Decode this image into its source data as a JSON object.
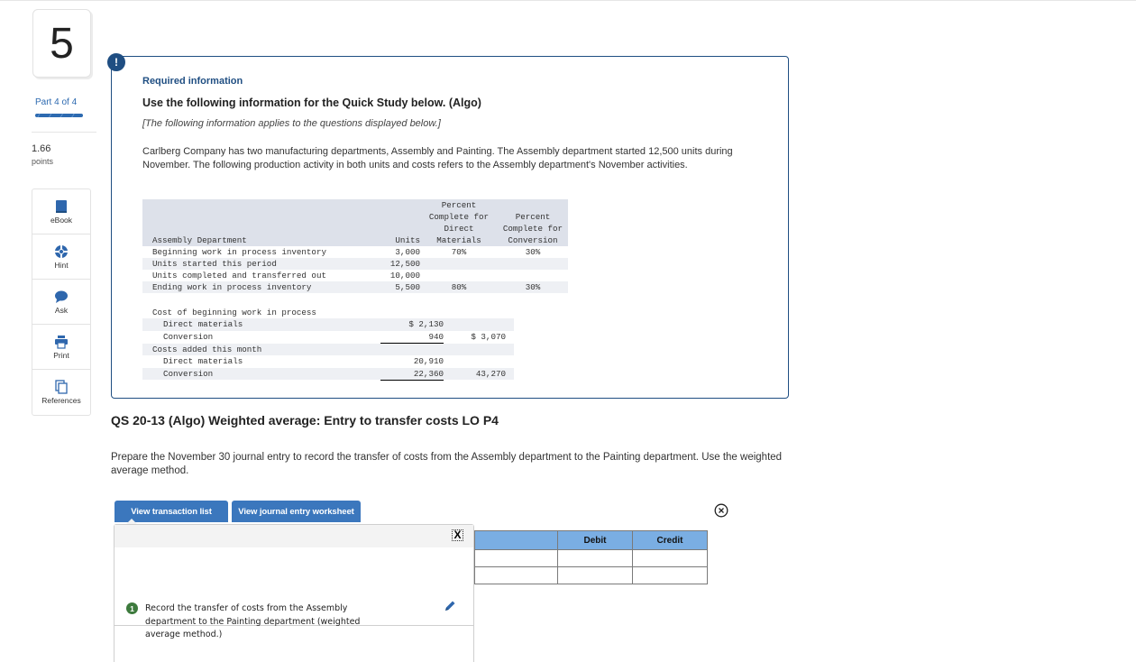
{
  "question": {
    "number": "5",
    "part_label": "Part",
    "part_current": "4",
    "part_of": "of 4",
    "part_progress": 1.0,
    "points_value": "1.66",
    "points_label": "points"
  },
  "tools": [
    {
      "label": "eBook",
      "icon": "book-icon"
    },
    {
      "label": "Hint",
      "icon": "lifebuoy-icon"
    },
    {
      "label": "Ask",
      "icon": "speech-bubble-icon"
    },
    {
      "label": "Print",
      "icon": "printer-icon"
    },
    {
      "label": "References",
      "icon": "copies-icon"
    }
  ],
  "info": {
    "badge": "!",
    "required": "Required information",
    "heading": "Use the following information for the Quick Study below. (Algo)",
    "applies": "[The following information applies to the questions displayed below.]",
    "paragraph": "Carlberg Company has two manufacturing departments, Assembly and Painting. The Assembly department started 12,500 units during November. The following production activity in both units and costs refers to the Assembly department's November activities."
  },
  "units_table": {
    "headers": {
      "dept": "Assembly Department",
      "units": "Units",
      "dm_lines": [
        "Percent",
        "Complete for",
        "Direct",
        "Materials"
      ],
      "conv_lines": [
        "Percent",
        "Complete for",
        "Conversion"
      ]
    },
    "rows": [
      {
        "label": "Beginning work in process inventory",
        "units": "3,000",
        "dm": "70%",
        "conv": "30%"
      },
      {
        "label": "Units started this period",
        "units": "12,500",
        "dm": "",
        "conv": ""
      },
      {
        "label": "Units completed and transferred out",
        "units": "10,000",
        "dm": "",
        "conv": ""
      },
      {
        "label": "Ending work in process inventory",
        "units": "5,500",
        "dm": "80%",
        "conv": "30%"
      }
    ]
  },
  "cost_table": {
    "rows": [
      {
        "label": "Cost of beginning work in process",
        "amount": "",
        "total": "",
        "indent": false
      },
      {
        "label": "Direct materials",
        "amount": "$ 2,130",
        "total": "",
        "indent": true
      },
      {
        "label": "Conversion",
        "amount": "940",
        "total": "$ 3,070",
        "indent": true
      },
      {
        "label": "Costs added this month",
        "amount": "",
        "total": "",
        "indent": false
      },
      {
        "label": "Direct materials",
        "amount": "20,910",
        "total": "",
        "indent": true
      },
      {
        "label": "Conversion",
        "amount": "22,360",
        "total": "43,270",
        "indent": true
      }
    ]
  },
  "qs": {
    "title": "QS 20-13 (Algo) Weighted average: Entry to transfer costs LO P4",
    "text": "Prepare the November 30 journal entry to record the transfer of costs from the Assembly department to the Painting department. Use the weighted average method."
  },
  "worksheet": {
    "btn_transactions": "View transaction list",
    "btn_journal": "View journal entry worksheet",
    "close_label": "X",
    "step_number": "1",
    "step_text": "Record the transfer of costs from the Assembly department to the Painting department (weighted average method.)",
    "journal_headers": [
      "",
      "Debit",
      "Credit"
    ],
    "journal_rows": [
      [
        "",
        "",
        ""
      ],
      [
        "",
        "",
        ""
      ]
    ]
  },
  "colors": {
    "brand_blue": "#1f4e82",
    "button_blue": "#3b77bd",
    "header_blue": "#7aaee3",
    "step_green": "#3d7a3d"
  }
}
